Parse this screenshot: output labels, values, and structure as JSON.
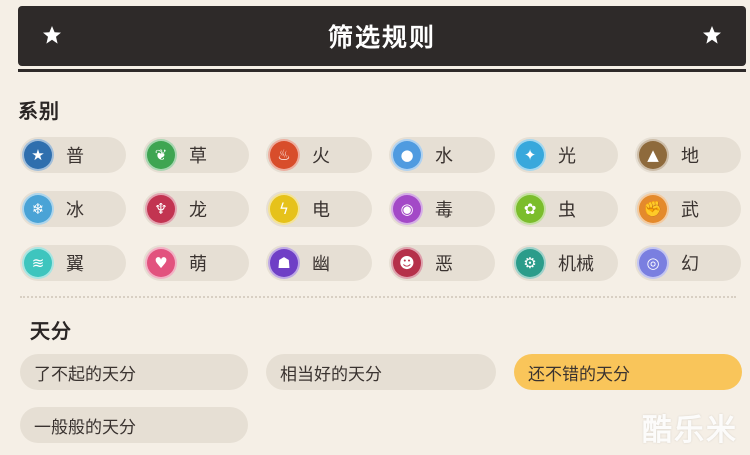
{
  "header": {
    "title": "筛选规则",
    "star_icon": "star-icon"
  },
  "types_section": {
    "label": "系别",
    "items": [
      {
        "label": "普",
        "icon": "star-badge-icon",
        "glyph": "★",
        "color": "#2f6fae"
      },
      {
        "label": "草",
        "icon": "leaf-icon",
        "glyph": "❦",
        "color": "#3ea552"
      },
      {
        "label": "火",
        "icon": "flame-icon",
        "glyph": "♨",
        "color": "#d84d2b"
      },
      {
        "label": "水",
        "icon": "water-drop-icon",
        "glyph": "●",
        "color": "#4f9be0"
      },
      {
        "label": "光",
        "icon": "light-icon",
        "glyph": "✦",
        "color": "#38a8dc"
      },
      {
        "label": "地",
        "icon": "mountain-icon",
        "glyph": "▲",
        "color": "#8e6a3c"
      },
      {
        "label": "冰",
        "icon": "snowflake-icon",
        "glyph": "❄",
        "color": "#4aa3d6"
      },
      {
        "label": "龙",
        "icon": "dragon-icon",
        "glyph": "♆",
        "color": "#c23451"
      },
      {
        "label": "电",
        "icon": "lightning-icon",
        "glyph": "ϟ",
        "color": "#e6c21a"
      },
      {
        "label": "毒",
        "icon": "poison-icon",
        "glyph": "◉",
        "color": "#a349c7"
      },
      {
        "label": "虫",
        "icon": "bug-icon",
        "glyph": "✿",
        "color": "#7bbd2c"
      },
      {
        "label": "武",
        "icon": "fist-icon",
        "glyph": "✊",
        "color": "#e48a2c"
      },
      {
        "label": "翼",
        "icon": "wing-icon",
        "glyph": "≋",
        "color": "#3ec5be"
      },
      {
        "label": "萌",
        "icon": "heart-icon",
        "glyph": "♥",
        "color": "#e2527e"
      },
      {
        "label": "幽",
        "icon": "ghost-icon",
        "glyph": "☗",
        "color": "#6f3fc6"
      },
      {
        "label": "恶",
        "icon": "demon-icon",
        "glyph": "☻",
        "color": "#b5304a"
      },
      {
        "label": "机械",
        "icon": "gear-icon",
        "glyph": "⚙",
        "color": "#2b9c8a"
      },
      {
        "label": "幻",
        "icon": "swirl-icon",
        "glyph": "◎",
        "color": "#7a7fe0"
      }
    ]
  },
  "talent_section": {
    "label": "天分",
    "items": [
      {
        "label": "了不起的天分",
        "selected": false
      },
      {
        "label": "相当好的天分",
        "selected": false
      },
      {
        "label": "还不错的天分",
        "selected": true
      },
      {
        "label": "一般般的天分",
        "selected": false
      }
    ],
    "active_color": "#f9c55a"
  },
  "watermark": "酷乐米"
}
